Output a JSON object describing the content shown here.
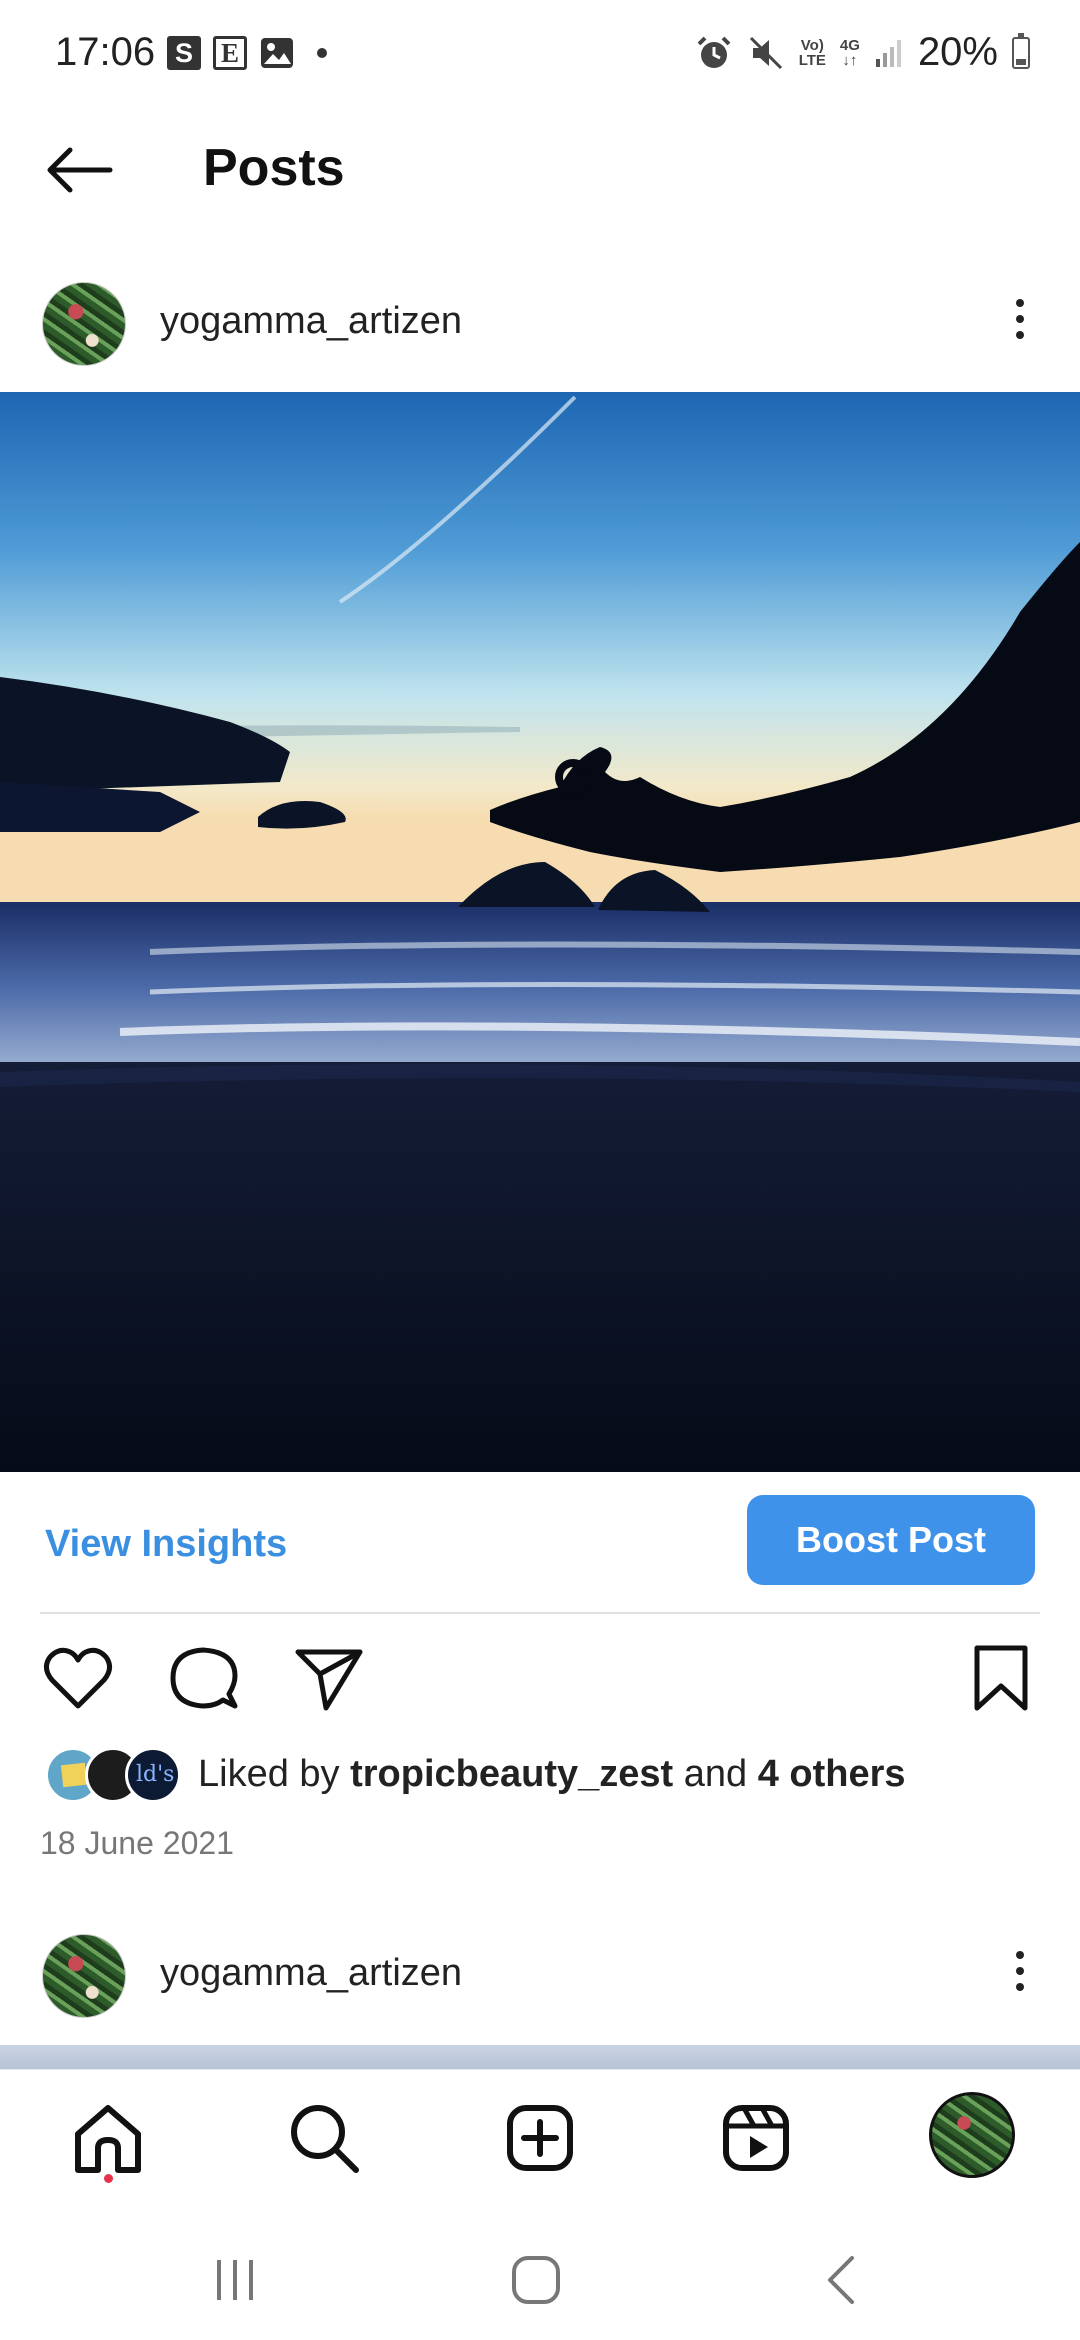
{
  "status_bar": {
    "time": "17:06",
    "icons_left": [
      "S",
      "E",
      "image-icon"
    ],
    "network_top": "Vo)",
    "network_bottom": "LTE",
    "data_top": "4G",
    "battery": "20%"
  },
  "header": {
    "title": "Posts"
  },
  "post": {
    "username": "yogamma_artizen",
    "image_alt": "Silhouette of a hand in a mudra gesture over the sea at dusk",
    "view_insights_label": "View Insights",
    "boost_label": "Boost Post",
    "liked_prefix": "Liked by",
    "liked_user": "tropicbeauty_zest",
    "liked_middle": "and",
    "liked_others": "4 others",
    "date": "18 June 2021"
  },
  "next_post": {
    "username": "yogamma_artizen"
  },
  "colors": {
    "accent": "#3f92ea",
    "link": "#3b8fe0",
    "notification_dot": "#e8324c"
  },
  "bottom_nav": [
    "home-icon",
    "search-icon",
    "create-icon",
    "reels-icon",
    "profile-avatar"
  ],
  "system_nav": [
    "recents-icon",
    "home-button-icon",
    "back-icon"
  ]
}
